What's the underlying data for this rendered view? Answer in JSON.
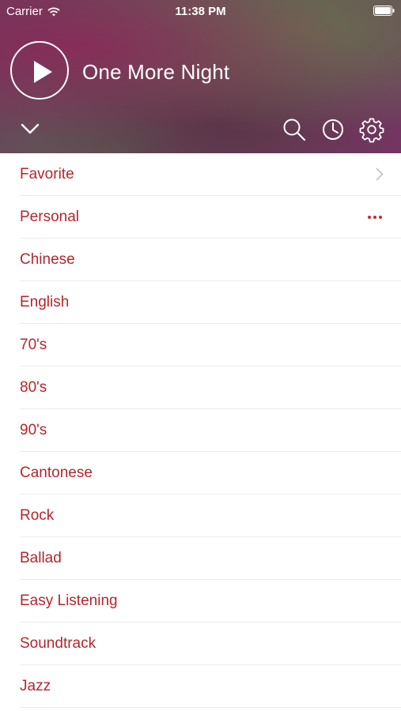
{
  "status_bar": {
    "carrier": "Carrier",
    "time": "11:38 PM"
  },
  "player": {
    "song_title": "One More Night"
  },
  "controls": {
    "icons": [
      "chevron-down-icon",
      "search-icon",
      "clock-icon",
      "gear-icon"
    ]
  },
  "channels": [
    {
      "label": "Favorite"
    },
    {
      "label": "Personal"
    },
    {
      "label": "Chinese"
    },
    {
      "label": "English"
    },
    {
      "label": "70's"
    },
    {
      "label": "80's"
    },
    {
      "label": "90's"
    },
    {
      "label": "Cantonese"
    },
    {
      "label": "Rock"
    },
    {
      "label": "Ballad"
    },
    {
      "label": "Easy Listening"
    },
    {
      "label": "Soundtrack"
    },
    {
      "label": "Jazz"
    }
  ],
  "colors": {
    "accent": "#b5262c",
    "header_tint": "#6d3a5b",
    "divider": "#ececec"
  }
}
